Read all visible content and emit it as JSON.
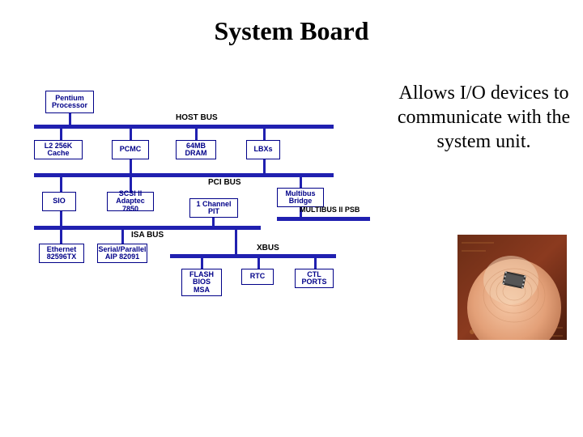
{
  "title": "System Board",
  "body": "Allows I/O devices to communicate with the system unit.",
  "diagram": {
    "buses": {
      "host": "HOST BUS",
      "pci": "PCI BUS",
      "isa": "ISA BUS",
      "multibus": "MULTIBUS II PSB",
      "xbus": "XBUS"
    },
    "blocks": {
      "cpu": "Pentium\nProcessor",
      "cache": "L2 256K\nCache",
      "pcmc": "PCMC",
      "dram": "64MB\nDRAM",
      "lbxs": "LBXs",
      "sio": "SIO",
      "scsi": "SCSI II\nAdaptec 7850",
      "pit": "1 Channel\nPIT",
      "bridge": "Multibus\nBridge",
      "ethernet": "Ethernet\n82596TX",
      "serpar": "Serial/Parallel\nAIP 82091",
      "flash": "FLASH\nBIOS\nMSA",
      "rtc": "RTC",
      "ctl": "CTL\nPORTS"
    }
  },
  "photo": {
    "description": "chip-on-fingertip"
  }
}
